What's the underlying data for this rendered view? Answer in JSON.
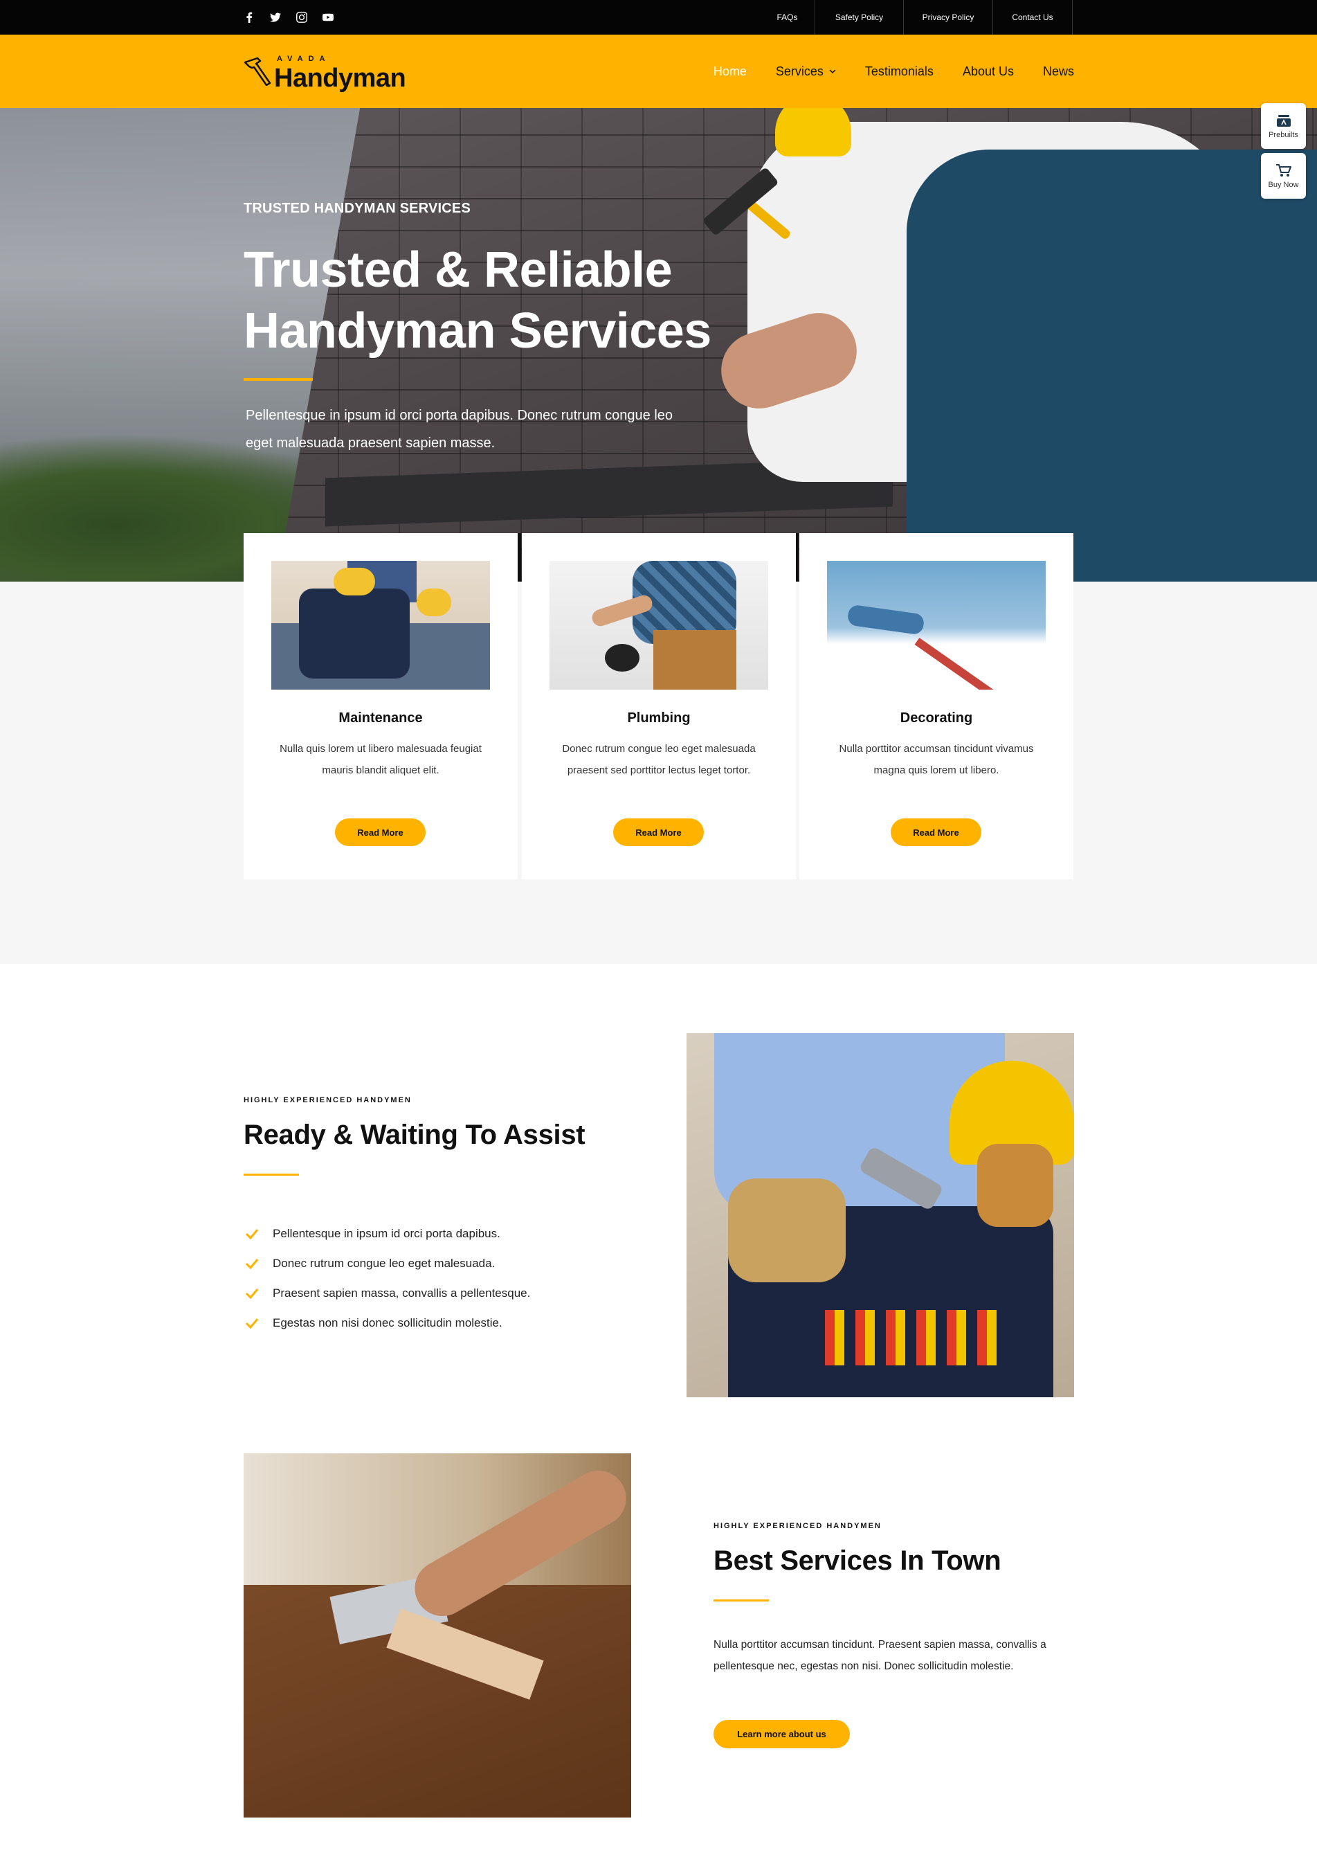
{
  "topbar": {
    "social": [
      "facebook-icon",
      "twitter-icon",
      "instagram-icon",
      "youtube-icon"
    ],
    "links": [
      "FAQs",
      "Safety Policy",
      "Privacy Policy",
      "Contact Us"
    ]
  },
  "header": {
    "logo_small": "AVADA",
    "logo_big": "Handyman",
    "nav": [
      "Home",
      "Services",
      "Testimonials",
      "About Us",
      "News"
    ]
  },
  "hero": {
    "subtitle": "TRUSTED HANDYMAN SERVICES",
    "title_line1": "Trusted & Reliable",
    "title_line2": "Handyman Services",
    "text": "Pellentesque in ipsum id orci porta dapibus. Donec rutrum congue leo eget malesuada praesent sapien masse."
  },
  "services": [
    {
      "title": "Maintenance",
      "desc": "Nulla quis lorem ut libero malesuada feugiat mauris blandit aliquet elit.",
      "button": "Read More"
    },
    {
      "title": "Plumbing",
      "desc": "Donec rutrum congue leo eget malesuada praesent sed porttitor lectus leget tortor.",
      "button": "Read More"
    },
    {
      "title": "Decorating",
      "desc": "Nulla porttitor accumsan tincidunt vivamus magna quis lorem ut libero.",
      "button": "Read More"
    }
  ],
  "ready": {
    "eyebrow": "HIGHLY EXPERIENCED HANDYMEN",
    "title": "Ready & Waiting To Assist",
    "items": [
      "Pellentesque in ipsum id orci porta dapibus.",
      "Donec rutrum congue leo eget malesuada.",
      "Praesent sapien massa, convallis a pellentesque.",
      "Egestas non nisi donec sollicitudin molestie."
    ]
  },
  "best": {
    "eyebrow": "HIGHLY EXPERIENCED HANDYMEN",
    "title": "Best Services In Town",
    "text": "Nulla porttitor accumsan tincidunt. Praesent sapien massa, convallis a pellentesque nec, egestas non nisi. Donec sollicitudin molestie.",
    "button": "Learn more about us"
  },
  "widgets": {
    "prebuilts": "Prebuilts",
    "buy_now": "Buy Now"
  },
  "colors": {
    "accent": "#ffb300",
    "topbar": "#050505",
    "band": "#f6f6f6"
  }
}
